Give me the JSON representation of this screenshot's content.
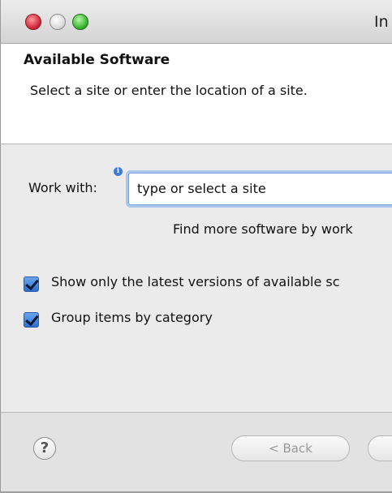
{
  "window": {
    "title": "In"
  },
  "header": {
    "title": "Available Software",
    "description": "Select a site or enter the location of a site."
  },
  "work_with": {
    "label": "Work with:",
    "input_value": "type or select a site",
    "find_more_text": "Find more software by work"
  },
  "options": {
    "latest_versions_label": "Show only the latest versions of available sc",
    "latest_versions_checked": true,
    "group_by_category_label": "Group items by category",
    "group_by_category_checked": true
  },
  "footer": {
    "help_symbol": "?",
    "back_label": "< Back"
  },
  "icons": {
    "close": "close-icon",
    "minimize": "minimize-icon",
    "zoom": "zoom-icon",
    "info": "info-icon",
    "help": "help-icon"
  },
  "colors": {
    "close": "#d2233a",
    "minimize": "#d9d9d9",
    "zoom": "#35b22e",
    "checkbox": "#2a6fd0",
    "focus_ring": "#a8c8f0"
  }
}
